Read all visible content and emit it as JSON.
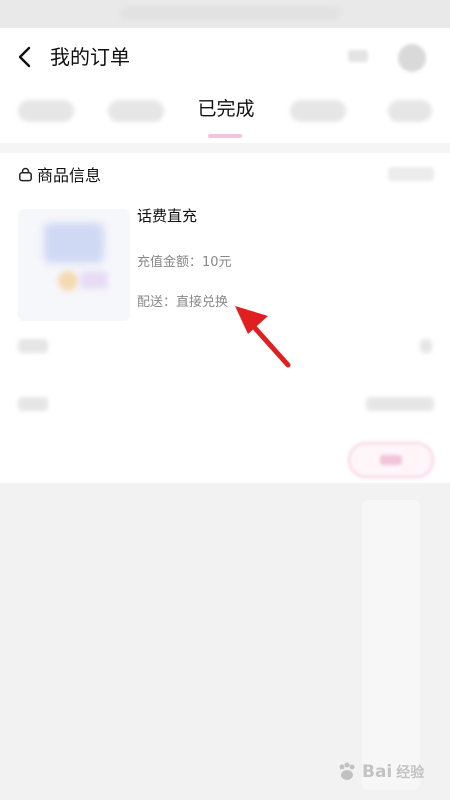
{
  "header": {
    "title": "我的订单"
  },
  "tabs": {
    "active_label": "已完成"
  },
  "product_section": {
    "title": "商品信息"
  },
  "product": {
    "name": "话费直充",
    "amount_line": "充值金额：10元",
    "delivery_line": "配送：直接兑换"
  },
  "watermark": {
    "text": "Bai",
    "subtext": "经验"
  },
  "colors": {
    "accent_pink": "#f2c3d9",
    "annotation_red": "#e02020",
    "muted_text": "#888888"
  }
}
